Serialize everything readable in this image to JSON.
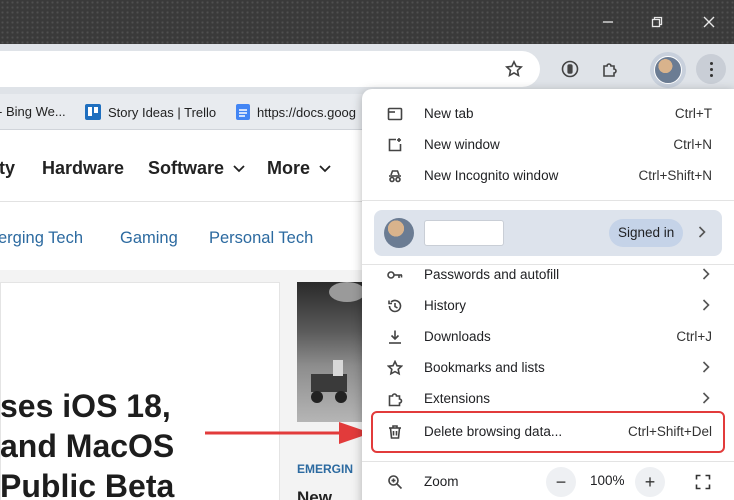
{
  "bookmarks": [
    {
      "label": "- Bing We..."
    },
    {
      "label": "Story Ideas | Trello"
    },
    {
      "label": "https://docs.goog"
    }
  ],
  "page": {
    "nav": [
      "ty",
      "Hardware",
      "Software",
      "More"
    ],
    "subnav": [
      "erging Tech",
      "Gaming",
      "Personal Tech"
    ],
    "headline": [
      "ses iOS 18,",
      "and MacOS",
      "Public Beta"
    ],
    "tag": "EMERGIN",
    "next_title": "New..."
  },
  "menu": {
    "items": [
      {
        "label": "New tab",
        "shortcut": "Ctrl+T"
      },
      {
        "label": "New window",
        "shortcut": "Ctrl+N"
      },
      {
        "label": "New Incognito window",
        "shortcut": "Ctrl+Shift+N"
      },
      {
        "label": "Passwords and autofill"
      },
      {
        "label": "History"
      },
      {
        "label": "Downloads",
        "shortcut": "Ctrl+J"
      },
      {
        "label": "Bookmarks and lists"
      },
      {
        "label": "Extensions"
      },
      {
        "label": "Delete browsing data...",
        "shortcut": "Ctrl+Shift+Del"
      },
      {
        "label": "Zoom"
      }
    ],
    "profile": {
      "signed_in": "Signed in"
    },
    "zoom": {
      "minus": "−",
      "value": "100%",
      "plus": "+"
    }
  },
  "colors": {
    "highlight": "#e23b3b",
    "arrow": "#e23b3b",
    "link": "#2c6aa0"
  }
}
